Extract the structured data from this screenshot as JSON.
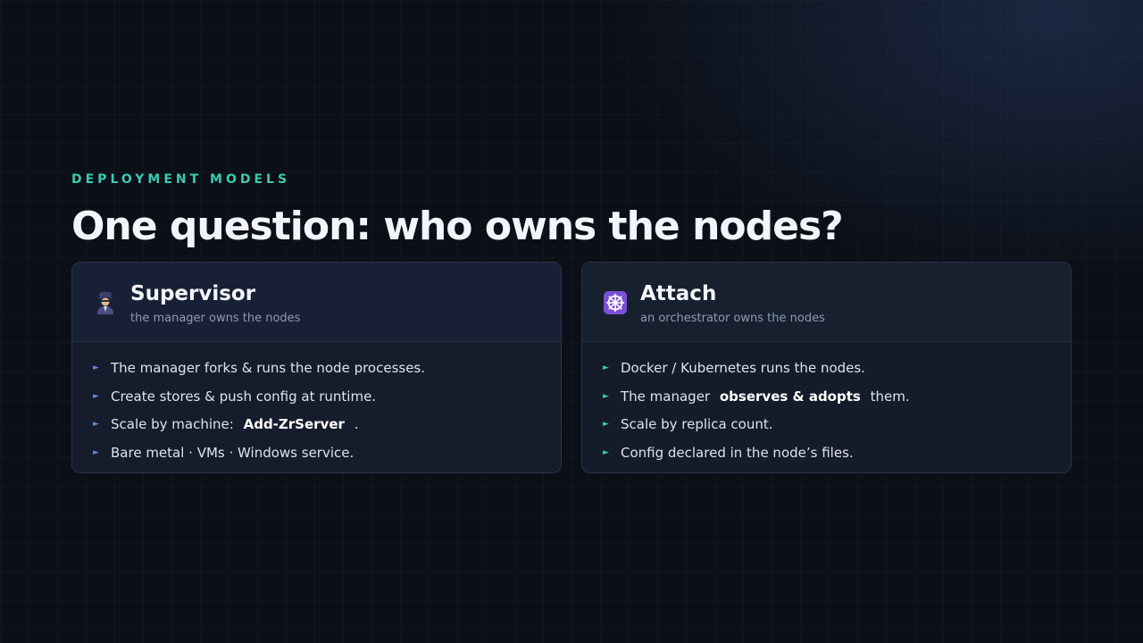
{
  "header": {
    "eyebrow": "DEPLOYMENT MODELS",
    "title": "One question: who owns the nodes?"
  },
  "cards": [
    {
      "icon": "supervisor-person-icon",
      "title": "Supervisor",
      "subtitle": "the manager owns the nodes",
      "items": [
        {
          "text": "The manager forks & runs the node processes."
        },
        {
          "text": "Create stores & push config at runtime."
        },
        {
          "pre": "Scale by machine:",
          "strong": "Add-ZrServer",
          "post": "."
        },
        {
          "text": "Bare metal · VMs · Windows service."
        }
      ]
    },
    {
      "icon": "ship-wheel-icon",
      "title": "Attach",
      "subtitle": "an orchestrator owns the nodes",
      "items": [
        {
          "text": "Docker / Kubernetes runs the nodes."
        },
        {
          "pre": "The manager",
          "strong": "observes & adopts",
          "post": "them."
        },
        {
          "text": "Scale by replica count."
        },
        {
          "text": "Config declared in the node’s files."
        }
      ]
    }
  ],
  "bullet_glyph": "►",
  "colors": {
    "accent_teal": "#3cc9b0",
    "accent_blue": "#5b8de0",
    "icon_purple": "#7b4fd6"
  }
}
